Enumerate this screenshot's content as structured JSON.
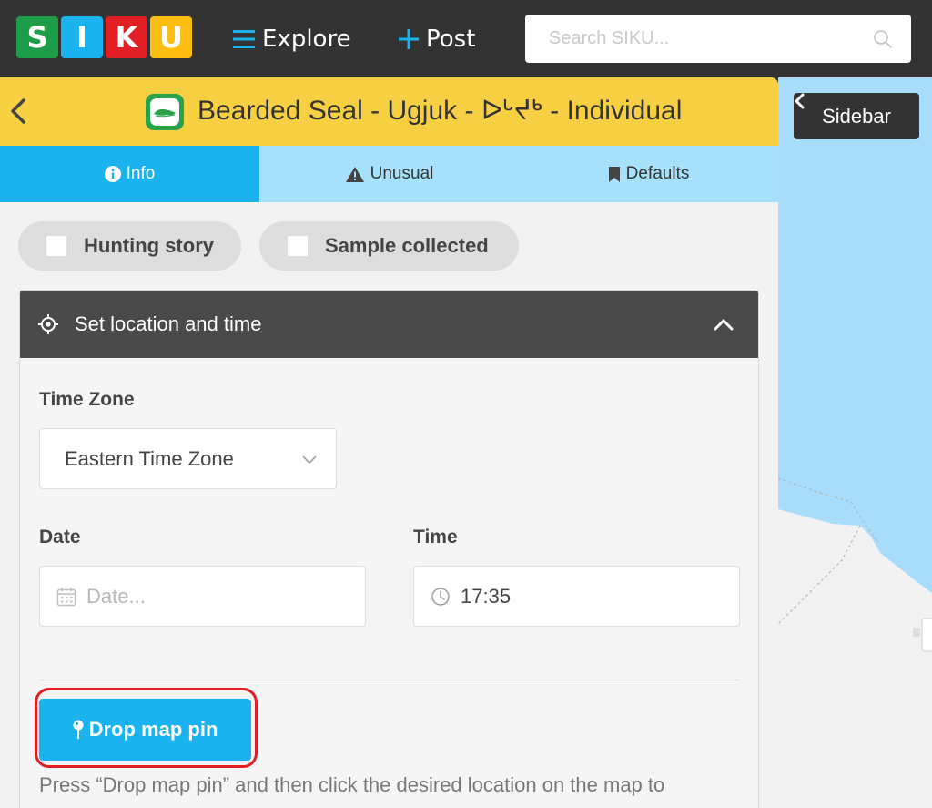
{
  "logo": {
    "letters": [
      "S",
      "I",
      "K",
      "U"
    ],
    "colors": [
      "#1d9d48",
      "#1ab3f0",
      "#e01e24",
      "#fcbf11"
    ]
  },
  "nav": {
    "explore_label": "Explore",
    "post_label": "Post"
  },
  "search": {
    "placeholder": "Search SIKU..."
  },
  "map": {
    "sidebar_label": "Sidebar"
  },
  "panel": {
    "title": "Bearded Seal - Ugjuk - ᐅᒡᔪᒃ - Individual",
    "tabs": [
      {
        "label": "Info",
        "icon": "info-icon",
        "active": true
      },
      {
        "label": "Unusual",
        "icon": "warning-icon",
        "active": false
      },
      {
        "label": "Defaults",
        "icon": "bookmark-icon",
        "active": false
      }
    ],
    "toggles": [
      {
        "label": "Hunting story",
        "checked": false
      },
      {
        "label": "Sample collected",
        "checked": false
      }
    ]
  },
  "location_card": {
    "title": "Set location and time",
    "time_zone_label": "Time Zone",
    "time_zone_value": "Eastern Time Zone",
    "date_label": "Date",
    "date_placeholder": "Date...",
    "time_label": "Time",
    "time_value": "17:35",
    "drop_pin_label": "Drop map pin",
    "help_text": "Press “Drop map pin” and then click the desired location on the map to"
  },
  "colors": {
    "accent_blue": "#1ab3f0",
    "header_yellow": "#f6d042",
    "highlight_red": "#e01e24",
    "dark": "#333333"
  }
}
